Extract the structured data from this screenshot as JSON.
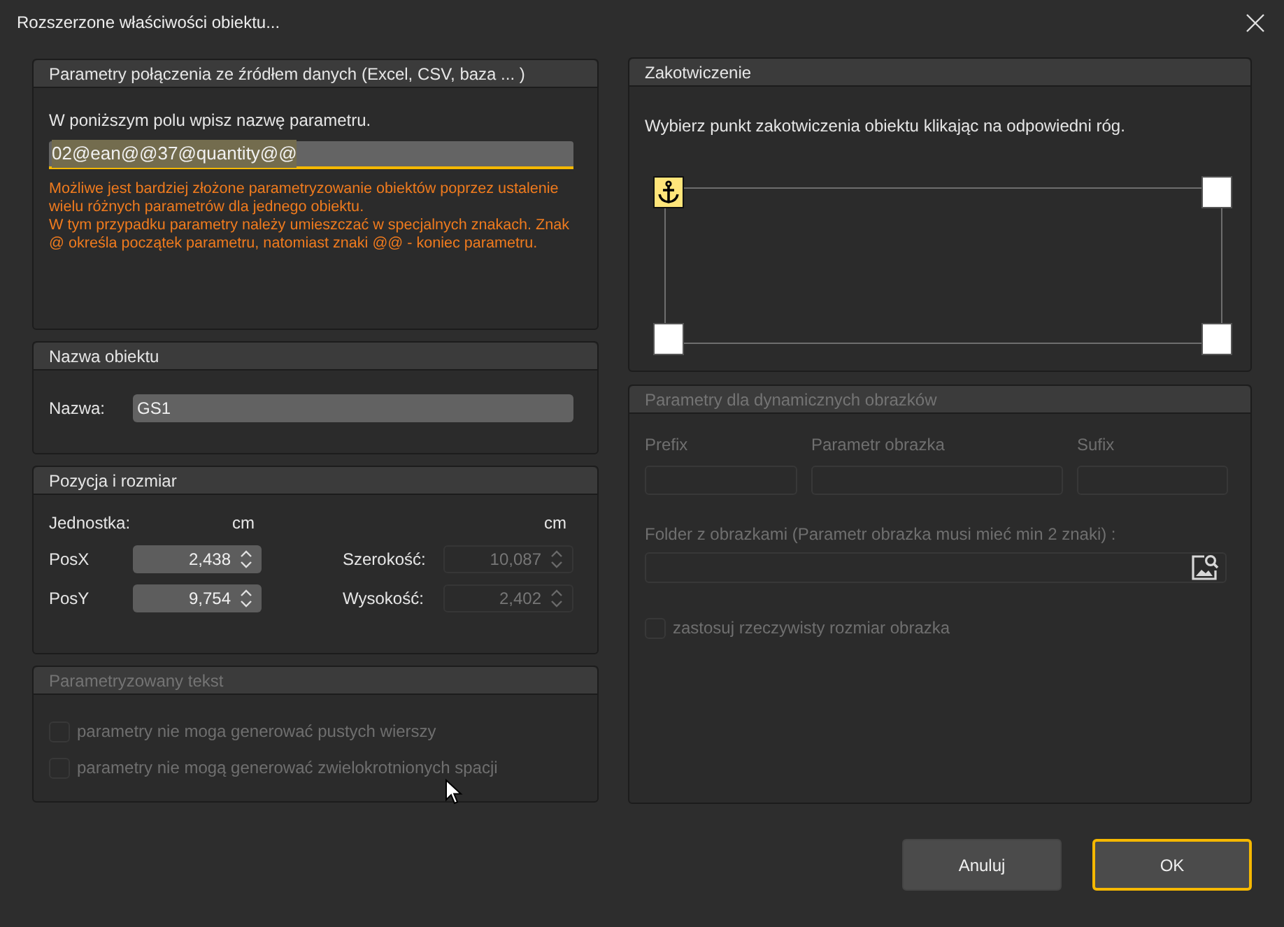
{
  "window": {
    "title": "Rozszerzone właściwości obiektu..."
  },
  "connection_panel": {
    "title": "Parametry połączenia ze źródłem danych (Excel, CSV, baza ... )",
    "instruction": "W poniższym polu wpisz nazwę parametru.",
    "parameter_field": {
      "value": "02@ean@@37@quantity@@",
      "focused": true,
      "text_selected": true
    },
    "help_paragraphs": [
      "Możliwe jest bardziej złożone parametryzowanie obiektów poprzez ustalenie wielu różnych parametrów dla jednego obiektu.",
      "W tym przypadku parametry należy umieszczać w specjalnych znakach. Znak @ określa początek parametru, natomiast znaki @@ - koniec parametru."
    ]
  },
  "name_panel": {
    "title": "Nazwa obiektu",
    "label": "Nazwa:",
    "value": "GS1"
  },
  "position_panel": {
    "title": "Pozycja i rozmiar",
    "unit_label": "Jednostka:",
    "units": [
      "cm",
      "cm"
    ],
    "fields": [
      {
        "label": "PosX",
        "value": "2,438",
        "disabled": false
      },
      {
        "label": "Szerokość:",
        "value": "10,087",
        "disabled": true
      },
      {
        "label": "PosY",
        "value": "9,754",
        "disabled": false
      },
      {
        "label": "Wysokość:",
        "value": "2,402",
        "disabled": true
      }
    ]
  },
  "text_panel": {
    "title": "Parametryzowany tekst",
    "disabled": true,
    "options": [
      {
        "label": "parametry nie moga generować pustych wierszy",
        "checked": false
      },
      {
        "label": "parametry nie mogą generować zwielokrotnionych spacji",
        "checked": false
      }
    ]
  },
  "anchor_panel": {
    "title": "Zakotwiczenie",
    "instruction": "Wybierz punkt zakotwiczenia obiektu klikając na odpowiedni róg.",
    "corners": [
      {
        "selected": true
      },
      {
        "selected": false
      },
      {
        "selected": false
      },
      {
        "selected": false
      }
    ]
  },
  "image_panel": {
    "title": "Parametry dla dynamicznych obrazków",
    "disabled": true,
    "fields": [
      {
        "label": "Prefix"
      },
      {
        "label": "Parametr obrazka"
      },
      {
        "label": "Sufix"
      }
    ],
    "folder": {
      "label": "Folder z obrazkami (Parametr obrazka musi mieć min 2 znaki) :"
    },
    "option": {
      "label": "zastosuj rzeczywisty rozmiar obrazka",
      "checked": false
    }
  },
  "buttons": [
    {
      "label": "Anuluj",
      "default": false
    },
    {
      "label": "OK",
      "default": true
    }
  ]
}
